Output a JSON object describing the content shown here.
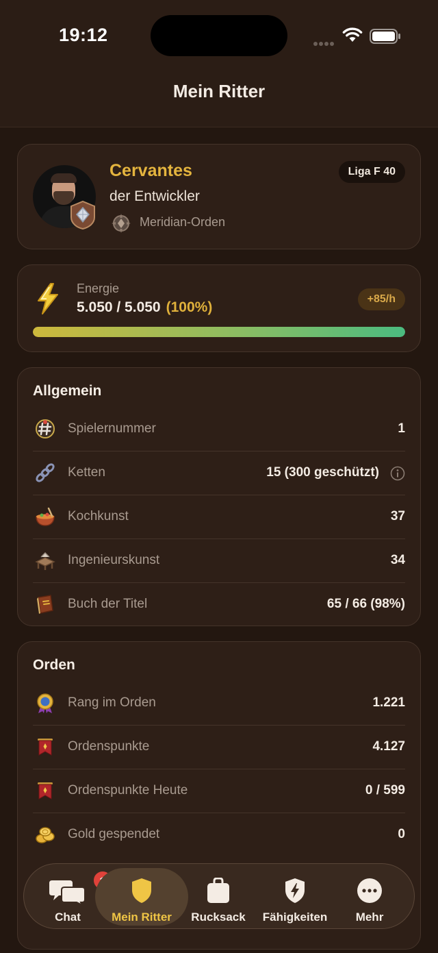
{
  "status_bar": {
    "time": "19:12"
  },
  "header": {
    "title": "Mein Ritter"
  },
  "profile": {
    "name": "Cervantes",
    "title": "der Entwickler",
    "order_name": "Meridian-Orden",
    "league": "Liga F 40"
  },
  "energy": {
    "label": "Energie",
    "value": "5.050 / 5.050",
    "percent_text": "(100%)",
    "rate": "+85/h",
    "fill_fraction": 1.0
  },
  "allgemein": {
    "title": "Allgemein",
    "rows": [
      {
        "icon": "player-number-icon",
        "label": "Spielernummer",
        "value": "1"
      },
      {
        "icon": "chains-icon",
        "label": "Ketten",
        "value": "15 (300 geschützt)",
        "info": true
      },
      {
        "icon": "cooking-icon",
        "label": "Kochkunst",
        "value": "37"
      },
      {
        "icon": "engineering-icon",
        "label": "Ingenieurskunst",
        "value": "34"
      },
      {
        "icon": "title-book-icon",
        "label": "Buch der Titel",
        "value": "65 / 66 (98%)"
      }
    ]
  },
  "orden": {
    "title": "Orden",
    "rows": [
      {
        "icon": "order-rank-icon",
        "label": "Rang im Orden",
        "value": "1.221"
      },
      {
        "icon": "order-points-icon",
        "label": "Ordenspunkte",
        "value": "4.127"
      },
      {
        "icon": "order-points-today-icon",
        "label": "Ordenspunkte Heute",
        "value": "0 / 599"
      },
      {
        "icon": "gold-icon",
        "label": "Gold gespendet",
        "value": "0"
      }
    ]
  },
  "tabbar": {
    "tabs": [
      {
        "label": "Chat",
        "icon": "chat-icon",
        "badge": "1"
      },
      {
        "label": "Mein Ritter",
        "icon": "shield-icon",
        "active": true
      },
      {
        "label": "Rucksack",
        "icon": "backpack-icon"
      },
      {
        "label": "Fähigkeiten",
        "icon": "abilities-icon"
      },
      {
        "label": "Mehr",
        "icon": "more-icon"
      }
    ]
  },
  "colors": {
    "background": "#231710",
    "card": "#2e1f17",
    "accent_gold": "#e4b43e",
    "energy_green": "#4bbb80",
    "badge_red": "#e0423a"
  }
}
